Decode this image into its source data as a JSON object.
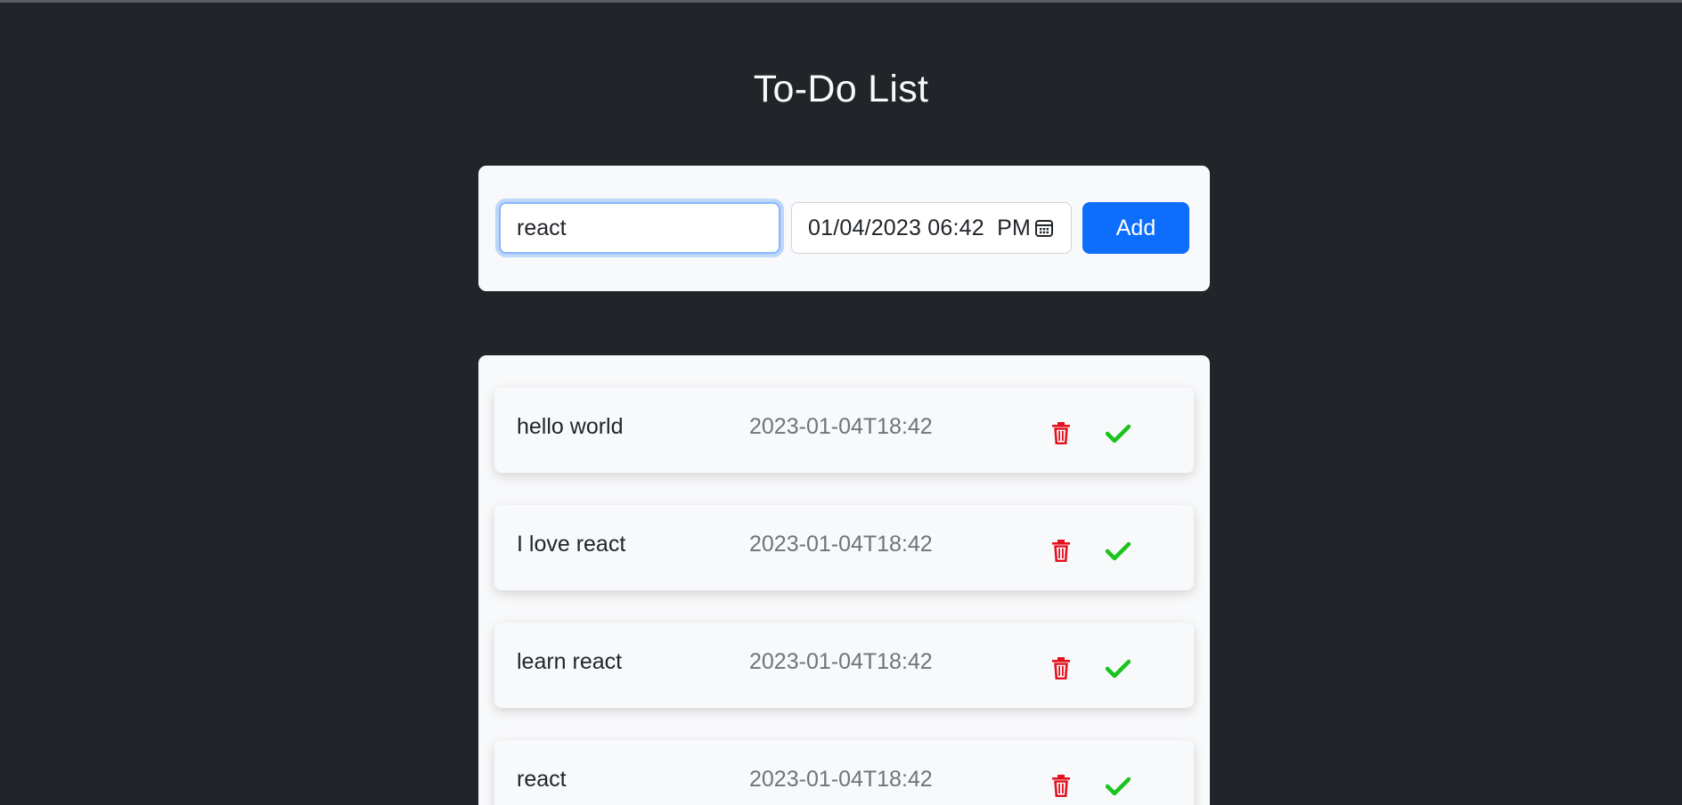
{
  "app": {
    "title": "To-Do List"
  },
  "form": {
    "task_value": "react",
    "datetime_value": "01/04/2023 06:42  PM",
    "add_label": "Add"
  },
  "todos": [
    {
      "text": "hello world",
      "date": "2023-01-04T18:42"
    },
    {
      "text": "I love react",
      "date": "2023-01-04T18:42"
    },
    {
      "text": "learn react",
      "date": "2023-01-04T18:42"
    },
    {
      "text": "react",
      "date": "2023-01-04T18:42"
    }
  ],
  "icons": {
    "delete": "trash-icon",
    "complete": "check-icon",
    "calendar": "calendar-icon"
  },
  "colors": {
    "background": "#212529",
    "card": "#f8f9fa",
    "accent": "#0d6efd",
    "delete": "#e3101f",
    "complete": "#19c41c"
  }
}
